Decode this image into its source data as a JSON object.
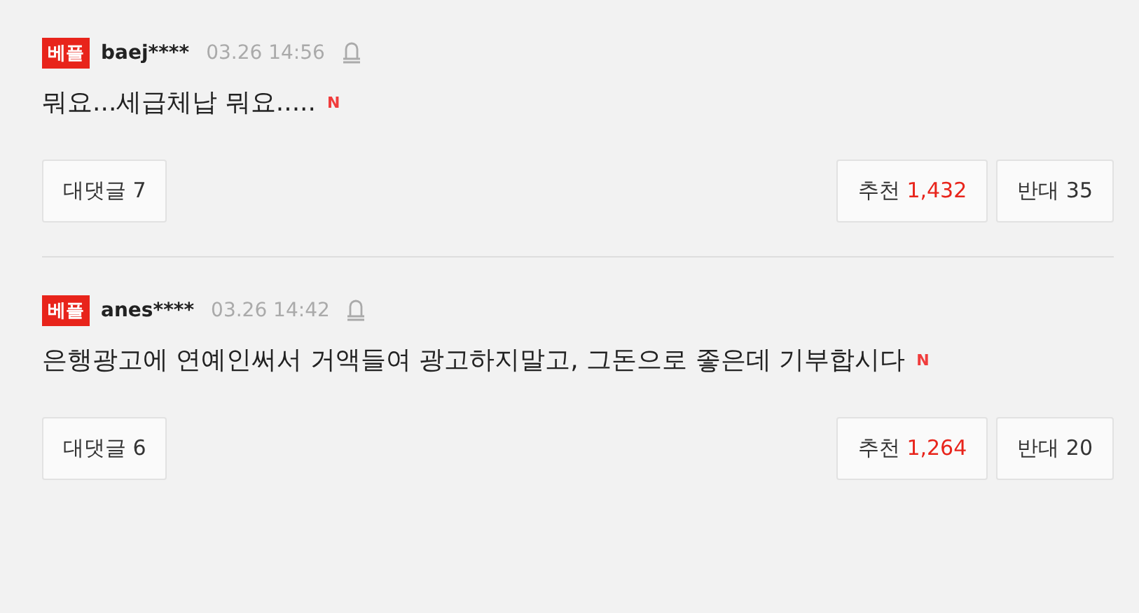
{
  "comments": [
    {
      "badge": "베플",
      "user": "baej****",
      "time": "03.26 14:56",
      "text": "뭐요...세급체납 뭐요.....",
      "new_mark": "N",
      "replies": {
        "label": "대댓글",
        "count": "7"
      },
      "like": {
        "label": "추천",
        "count": "1,432"
      },
      "dislike": {
        "label": "반대",
        "count": "35"
      }
    },
    {
      "badge": "베플",
      "user": "anes****",
      "time": "03.26 14:42",
      "text": "은행광고에 연예인써서 거액들여 광고하지말고, 그돈으로 좋은데 기부합시다",
      "new_mark": "N",
      "replies": {
        "label": "대댓글",
        "count": "6"
      },
      "like": {
        "label": "추천",
        "count": "1,264"
      },
      "dislike": {
        "label": "반대",
        "count": "20"
      }
    }
  ]
}
